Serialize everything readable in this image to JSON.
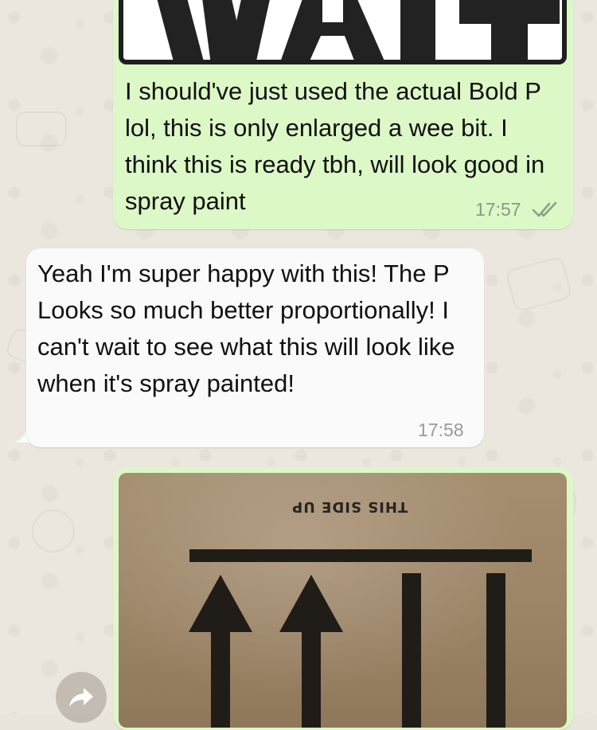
{
  "messages": [
    {
      "direction": "outgoing",
      "image": "wait-sign-image",
      "text": "I should've just used the actual Bold P lol, this is only enlarged a wee bit. I think this is ready tbh, will look good in spray paint",
      "time": "17:57",
      "status_icon": "double-check-icon"
    },
    {
      "direction": "incoming",
      "text": "Yeah I'm super happy with this! The P Looks so much better proportionally! I can't wait to see what this will look like when it's spray painted!",
      "time": "17:58"
    },
    {
      "direction": "outgoing",
      "image": "cardboard-stencil-photo",
      "stamp_text": "THIS SIDE UP"
    }
  ],
  "actions": {
    "forward_icon": "forward-arrow-icon"
  },
  "colors": {
    "outgoing_bubble": "#dcf8c6",
    "incoming_bubble": "#fafafa",
    "wallpaper": "#ebe6de"
  }
}
